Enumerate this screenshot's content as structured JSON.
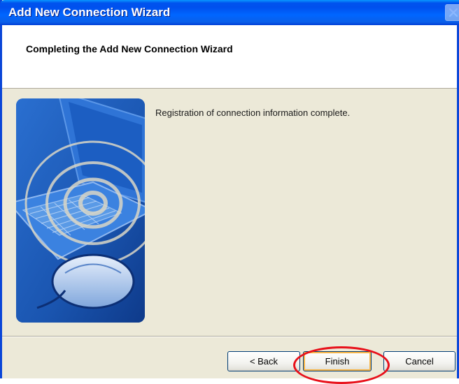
{
  "window": {
    "title": "Add New Connection Wizard",
    "close_icon": "close-icon"
  },
  "header": {
    "title": "Completing the Add New Connection Wizard"
  },
  "content": {
    "message": "Registration of connection information complete.",
    "illustration": "laptop-wireless-illustration"
  },
  "buttons": {
    "back_label": "< Back",
    "finish_label": "Finish",
    "cancel_label": "Cancel"
  },
  "annotation": {
    "highlight_color": "#e8101a",
    "highlighted": "finish-button"
  },
  "colors": {
    "titlebar": "#0053ee",
    "dialog_bg": "#ece9d8",
    "art_bg": "#1f5db8"
  }
}
